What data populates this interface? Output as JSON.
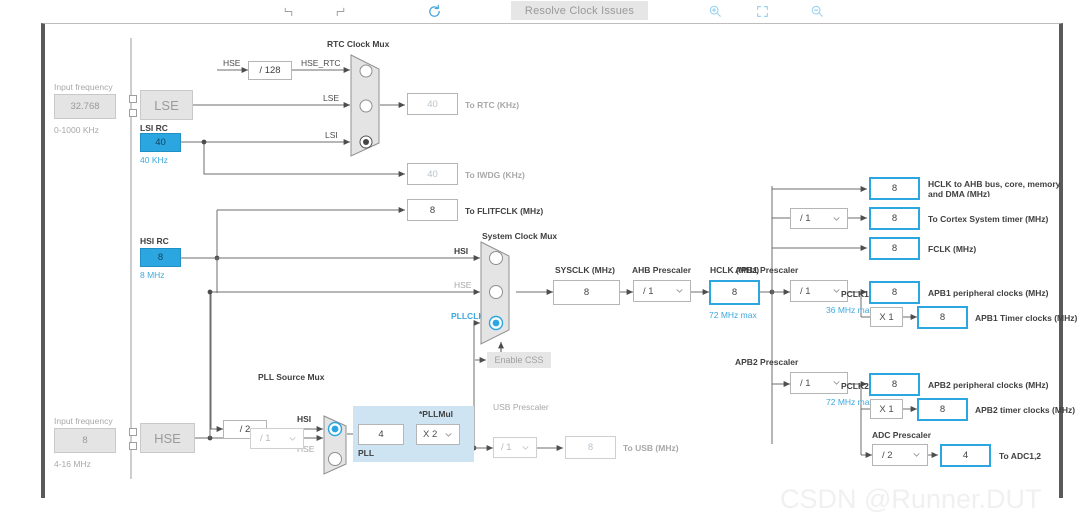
{
  "toolbar": {
    "undo": {
      "name": "undo-icon",
      "title": "Undo"
    },
    "redo": {
      "name": "redo-icon",
      "title": "Redo"
    },
    "refresh": {
      "name": "refresh-icon",
      "title": "Refresh"
    },
    "resolve_label": "Resolve Clock Issues",
    "zoom_in": {
      "name": "zoom-in-icon",
      "title": "Zoom In"
    },
    "fit": {
      "name": "fit-screen-icon",
      "title": "Fit to Screen"
    },
    "zoom_out": {
      "name": "zoom-out-icon",
      "title": "Zoom Out"
    }
  },
  "watermark": "CSDN @Runner.DUT",
  "lse": {
    "input_frequency_label": "Input frequency",
    "input_frequency_value": "32.768",
    "range": "0-1000 KHz",
    "osc_label": "LSE"
  },
  "hse": {
    "input_frequency_label": "Input frequency",
    "input_frequency_value": "8",
    "range": "4-16 MHz",
    "osc_label": "HSE",
    "prescaler": "/ 1"
  },
  "lsi": {
    "title": "LSI RC",
    "value": "40",
    "unit": "40 KHz"
  },
  "hsi": {
    "title": "HSI RC",
    "value": "8",
    "unit": "8 MHz"
  },
  "rtc_mux": {
    "title": "RTC Clock Mux",
    "hse_label": "HSE",
    "divider": "/ 128",
    "hse_rtc_label": "HSE_RTC",
    "lse_label": "LSE",
    "lsi_label": "LSI",
    "selected_index": 2
  },
  "outputs": {
    "rtc": {
      "value": "40",
      "label": "To RTC (KHz)",
      "state": "dim"
    },
    "iwdg": {
      "value": "40",
      "label": "To IWDG (KHz)",
      "state": "dim"
    },
    "flitfclk": {
      "value": "8",
      "label": "To FLITFCLK (MHz)",
      "state": "plain"
    },
    "usb": {
      "value": "8",
      "label": "To USB (MHz)",
      "state": "dim"
    },
    "hclk_ahb": {
      "value": "8",
      "label": "HCLK to AHB bus, core, memory and DMA (MHz)",
      "state": "active"
    },
    "cortex_timer": {
      "value": "8",
      "label": "To Cortex System timer (MHz)",
      "state": "active"
    },
    "fclk": {
      "value": "8",
      "label": "FCLK (MHz)",
      "state": "active"
    },
    "apb1_periph": {
      "value": "8",
      "label": "APB1 peripheral clocks (MHz)",
      "state": "active"
    },
    "apb1_timer": {
      "value": "8",
      "label": "APB1 Timer clocks (MHz)",
      "state": "active"
    },
    "apb2_periph": {
      "value": "8",
      "label": "APB2 peripheral clocks (MHz)",
      "state": "active"
    },
    "apb2_timer": {
      "value": "8",
      "label": "APB2 timer clocks (MHz)",
      "state": "active"
    },
    "adc": {
      "value": "4",
      "label": "To ADC1,2",
      "state": "active"
    }
  },
  "system_mux": {
    "title": "System Clock Mux",
    "hsi_label": "HSI",
    "hse_label": "HSE",
    "pllclk_label": "PLLCLK",
    "selected_index": 2,
    "enable_css_label": "Enable CSS"
  },
  "sysclk": {
    "label": "SYSCLK (MHz)",
    "value": "8"
  },
  "ahb_prescaler": {
    "label": "AHB Prescaler",
    "value": "/ 1"
  },
  "hclk": {
    "label": "HCLK (MHz)",
    "value": "8",
    "max": "72 MHz max"
  },
  "cortex_prescaler": {
    "value": "/ 1"
  },
  "apb1": {
    "label": "APB1 Prescaler",
    "value": "/ 1",
    "pclk_label": "PCLK1",
    "max": "36 MHz max",
    "timer_mul": "X 1"
  },
  "apb2": {
    "label": "APB2 Prescaler",
    "value": "/ 1",
    "pclk_label": "PCLK2",
    "max": "72 MHz max",
    "timer_mul": "X 1"
  },
  "adc_prescaler": {
    "label": "ADC Prescaler",
    "value": "/ 2"
  },
  "pll": {
    "source_mux_title": "PLL Source Mux",
    "hsi_div": "/ 2",
    "hsi_label": "HSI",
    "hse_label": "HSE",
    "selected_index": 0,
    "block_label": "PLL",
    "pll_div_value": "4",
    "pllmul_label": "*PLLMul",
    "pllmul_value": "X 2"
  },
  "usb_prescaler": {
    "label": "USB Prescaler",
    "value": "/ 1"
  },
  "colors": {
    "accent": "#2ba6e0",
    "osc_fill": "#2ba6e0",
    "pll_bg": "#cfe4f3",
    "wire": "#6e6e6e",
    "dim_text": "#b9c4cc"
  }
}
